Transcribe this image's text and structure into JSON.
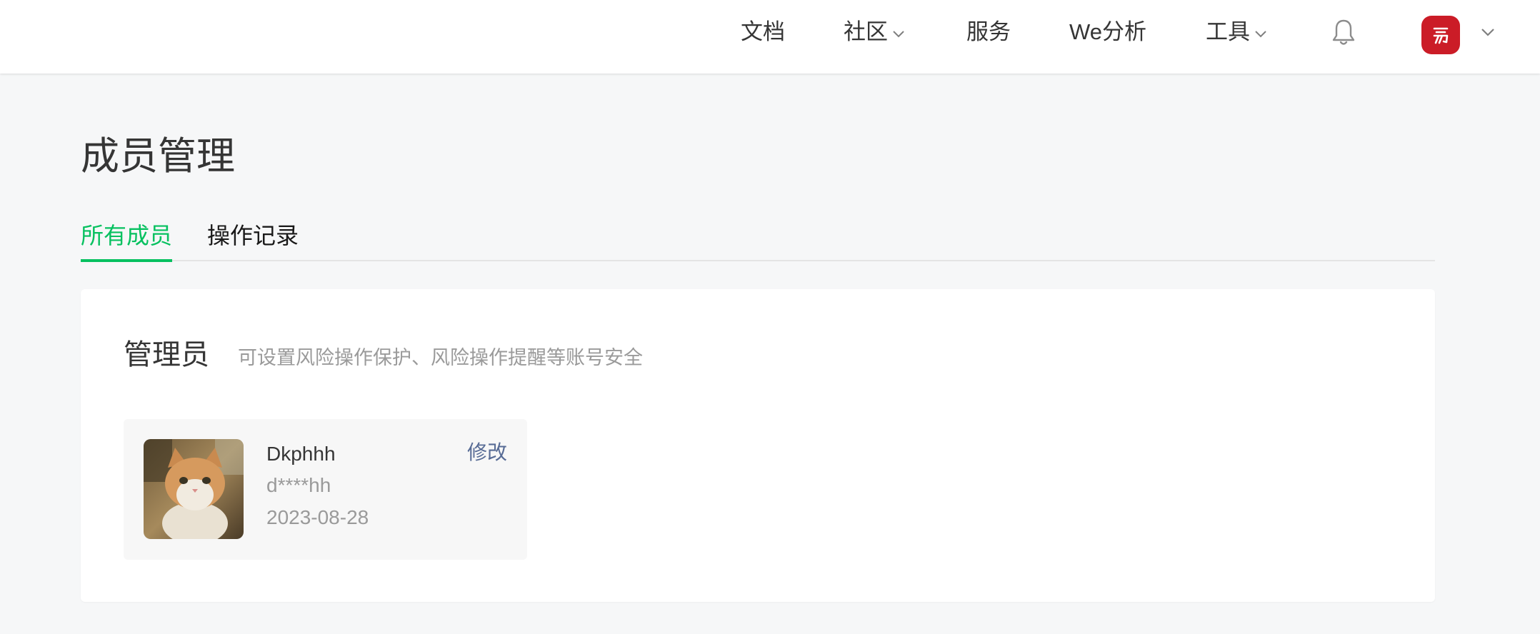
{
  "nav": {
    "items": [
      {
        "label": "文档",
        "has_dropdown": false
      },
      {
        "label": "社区",
        "has_dropdown": true
      },
      {
        "label": "服务",
        "has_dropdown": false
      },
      {
        "label": "We分析",
        "has_dropdown": false
      },
      {
        "label": "工具",
        "has_dropdown": true
      }
    ],
    "notification_icon": "bell-icon",
    "account_avatar_color": "#cb1c27",
    "account_dropdown_icon": "chevron-down-icon"
  },
  "page": {
    "title": "成员管理"
  },
  "tabs": [
    {
      "label": "所有成员",
      "active": true
    },
    {
      "label": "操作记录",
      "active": false
    }
  ],
  "admin_section": {
    "title": "管理员",
    "description": "可设置风险操作保护、风险操作提醒等账号安全",
    "member": {
      "name": "Dkphhh",
      "wechat_id": "d****hh",
      "date": "2023-08-28",
      "edit_label": "修改"
    }
  },
  "colors": {
    "accent": "#07c160",
    "link": "#576b95",
    "background": "#f6f7f8"
  }
}
